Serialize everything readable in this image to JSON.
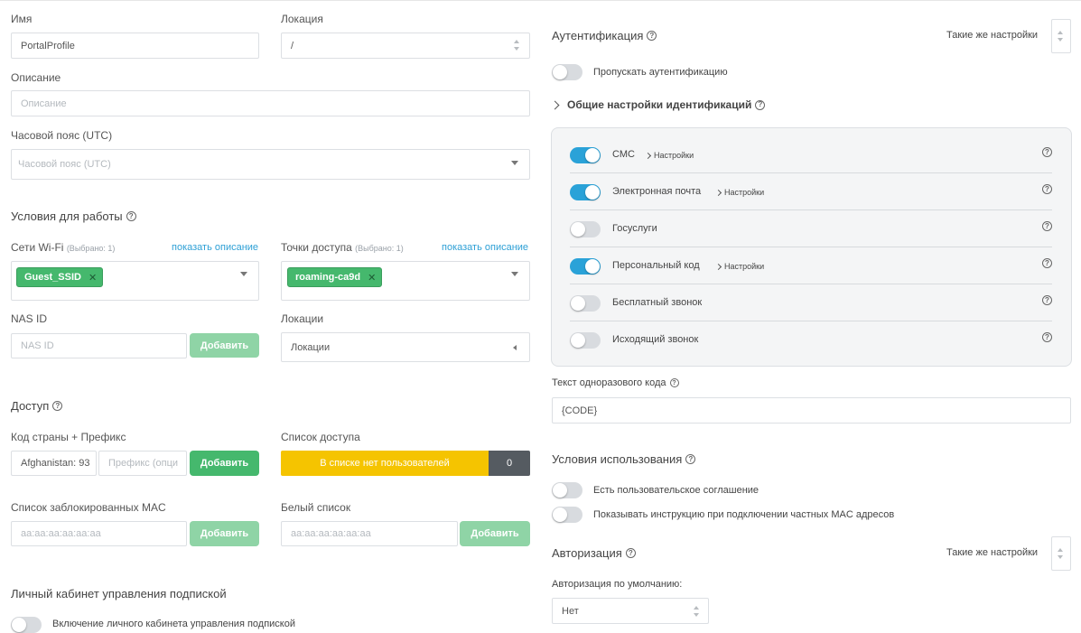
{
  "left": {
    "name_label": "Имя",
    "name_value": "PortalProfile",
    "location_label": "Локация",
    "location_value": "/",
    "description_label": "Описание",
    "description_placeholder": "Описание",
    "timezone_label": "Часовой пояс (UTC)",
    "timezone_placeholder": "Часовой пояс (UTC)",
    "work_conditions_title": "Условия для работы",
    "wifi_label": "Сети Wi-Fi",
    "wifi_selected": "(Выбрано: 1)",
    "wifi_show_desc": "показать описание",
    "wifi_chip": "Guest_SSID",
    "ap_label": "Точки доступа",
    "ap_selected": "(Выбрано: 1)",
    "ap_show_desc": "показать описание",
    "ap_chip": "roaming-ca9d",
    "nasid_label": "NAS ID",
    "nasid_placeholder": "NAS ID",
    "add_label": "Добавить",
    "locations_label": "Локации",
    "locations_placeholder": "Локации",
    "access_title": "Доступ",
    "country_label": "Код страны + Префикс",
    "country_value": "Afghanistan: 93",
    "prefix_placeholder": "Префикс (опци",
    "access_list_label": "Список доступа",
    "access_list_empty": "В списке нет пользователей",
    "access_list_count": "0",
    "blocked_mac_label": "Список заблокированных MAC",
    "mac_placeholder": "aa:aa:aa:aa:aa:aa",
    "whitelist_label": "Белый список",
    "cabinet_title": "Личный кабинет управления подпиской",
    "cabinet_toggle_label": "Включение личного кабинета управления подпиской"
  },
  "right": {
    "auth_title": "Аутентификация",
    "same_settings": "Такие же настройки",
    "skip_auth_label": "Пропускать аутентификацию",
    "common_id_settings": "Общие настройки идентификаций",
    "settings_link": "Настройки",
    "methods": [
      {
        "name": "СМС",
        "on": true,
        "has_settings": true
      },
      {
        "name": "Электронная почта",
        "on": true,
        "has_settings": true
      },
      {
        "name": "Госуслуги",
        "on": false,
        "has_settings": false
      },
      {
        "name": "Персональный код",
        "on": true,
        "has_settings": true
      },
      {
        "name": "Бесплатный звонок",
        "on": false,
        "has_settings": false
      },
      {
        "name": "Исходящий звонок",
        "on": false,
        "has_settings": false
      }
    ],
    "otp_text_label": "Текст одноразового кода",
    "otp_text_value": "{CODE}",
    "terms_title": "Условия использования",
    "user_agreement_label": "Есть пользовательское соглашение",
    "mac_instruction_label": "Показывать инструкцию при подключении частных MAC адресов",
    "authz_title": "Авторизация",
    "authz_default_label": "Авторизация по умолчанию:",
    "authz_default_value": "Нет"
  },
  "colors": {
    "accent_blue": "#2aa2d8",
    "green": "#45b86d",
    "green_light": "#8fd4a6",
    "yellow": "#f5c400",
    "dark_badge": "#555b61"
  }
}
